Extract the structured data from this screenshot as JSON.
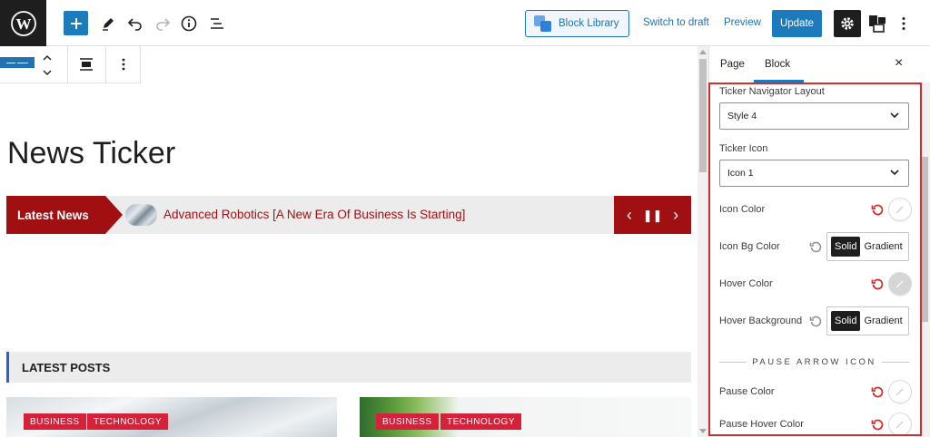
{
  "topbar": {
    "wp_logo_icon": "wordpress-logo",
    "block_library_label": "Block Library",
    "switch_to_draft_label": "Switch to draft",
    "preview_label": "Preview",
    "update_label": "Update"
  },
  "content": {
    "page_title": "News Ticker",
    "ticker": {
      "label": "Latest News",
      "headline": "Advanced Robotics [A New Era Of Business Is Starting]",
      "prev": "‹",
      "pause": "❚❚",
      "next": "›"
    },
    "latest_posts_title": "LATEST POSTS",
    "posts": [
      {
        "tags": [
          "BUSINESS",
          "TECHNOLOGY"
        ]
      },
      {
        "tags": [
          "BUSINESS",
          "TECHNOLOGY"
        ]
      }
    ]
  },
  "sidebar": {
    "tabs": [
      "Page",
      "Block"
    ],
    "active_tab": "Block",
    "close": "×",
    "fields": {
      "navigator_layout_label": "Ticker Navigator Layout",
      "navigator_layout_value": "Style 4",
      "ticker_icon_label": "Ticker Icon",
      "ticker_icon_value": "Icon 1",
      "icon_color_label": "Icon Color",
      "icon_bg_color_label": "Icon Bg Color",
      "hover_color_label": "Hover Color",
      "hover_background_label": "Hover Background",
      "solid_label": "Solid",
      "gradient_label": "Gradient",
      "pause_section_title": "PAUSE ARROW ICON",
      "pause_color_label": "Pause Color",
      "pause_hover_color_label": "Pause Hover Color"
    }
  },
  "colors": {
    "ticker_red": "#a01012",
    "wp_blue": "#1b7bbd",
    "tag_red": "#d3223a",
    "highlight_red": "#d52c2c"
  }
}
